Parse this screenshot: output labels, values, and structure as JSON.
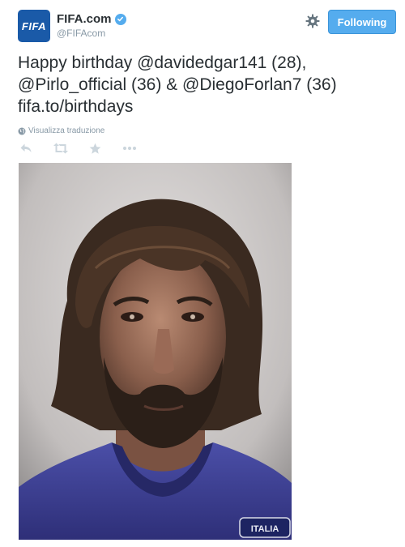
{
  "account": {
    "display_name": "FIFA.com",
    "handle": "@FIFAcom",
    "avatar_text": "FIFA",
    "verified": true
  },
  "follow_button": {
    "label": "Following"
  },
  "tweet": {
    "lines": [
      "Happy birthday @davidedgar141 (28),",
      "@Pirlo_official (36) & @DiegoForlan7 (36)",
      "fifa.to/birthdays"
    ]
  },
  "translate": {
    "label": "Visualizza traduzione",
    "icon": "globe-icon"
  },
  "actions": [
    {
      "name": "reply",
      "icon": "reply-icon"
    },
    {
      "name": "retweet",
      "icon": "retweet-icon"
    },
    {
      "name": "favorite",
      "icon": "star-icon"
    },
    {
      "name": "more",
      "icon": "more-icon"
    }
  ],
  "photo": {
    "badge_text": "ITALIA"
  },
  "colors": {
    "accent": "#55acee",
    "text": "#292f33",
    "muted": "#8899a6",
    "avatar_bg": "#1a5aa8"
  }
}
